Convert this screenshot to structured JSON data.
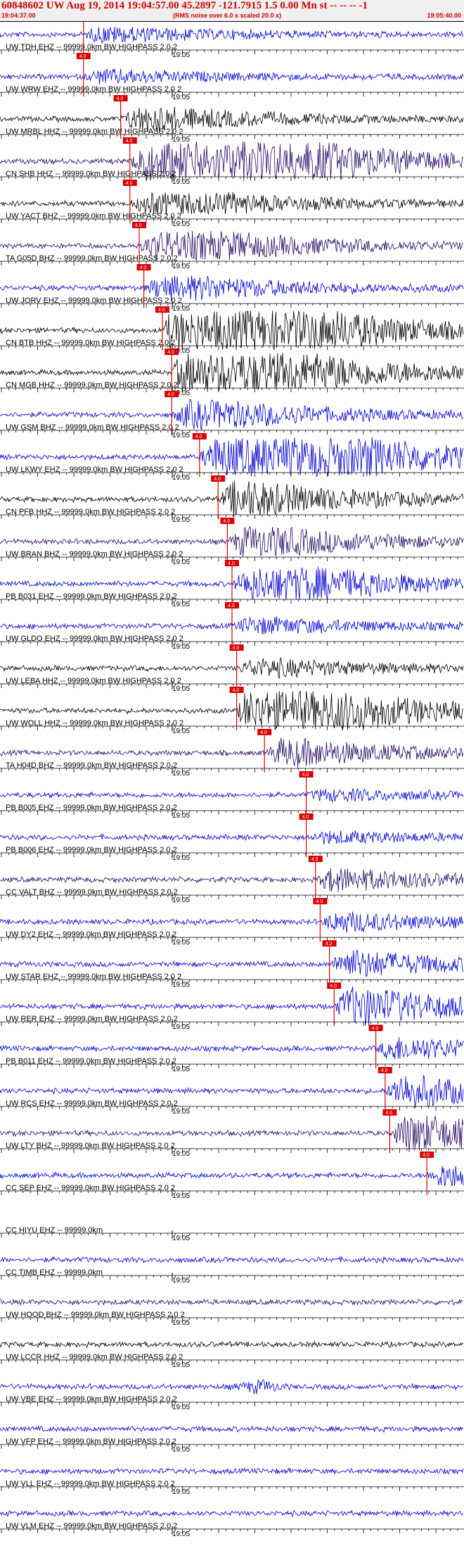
{
  "header": {
    "title": "60848602 UW Aug 19, 2014 19:04:57.00   45.2897 -121.7915  1.5 0.00 Mn st -- -- --  -1",
    "start_time": "19:04:37.00",
    "note": "(RMS noise over 6.0 s scaled 20.0 x)",
    "end_time": "19:05:40.00"
  },
  "axis": {
    "minute_label": "19:05"
  },
  "colors": {
    "black": "#000000",
    "blue": "#0000d0",
    "purple": "#2a0a66",
    "pick": "#dd0000"
  },
  "pick_label": "4.0",
  "traces": [
    {
      "label": "UW TDH EHZ -- 99999.0km BW  HIGHPASS  2.0  2",
      "color": "blue",
      "pick": 0.18,
      "event": 0.25,
      "env": 0.6
    },
    {
      "label": "UW WRW EHZ -- 99999.0km BW  HIGHPASS  2.0  2",
      "color": "blue",
      "pick": 0.18,
      "event": 0.25,
      "env": 0.5
    },
    {
      "label": "UW MRBL HHZ -- 99999.0km BW  HIGHPASS  2.0  2",
      "color": "black",
      "pick": 0.26,
      "event": 0.35,
      "env": 1.0
    },
    {
      "label": "CN SHB HHZ -- 99999.0km BW  HIGHPASS  2.0  2",
      "color": "purple",
      "pick": 0.28,
      "event": 0.55,
      "env": 3.0
    },
    {
      "label": "UW YACT BHZ -- 99999.0km BW  HIGHPASS  2.0  2",
      "color": "black",
      "pick": 0.28,
      "event": 0.5,
      "env": 0.8
    },
    {
      "label": "TA G05D BHZ -- 99999.0km BW  HIGHPASS  2.0  2",
      "color": "purple",
      "pick": 0.3,
      "event": 0.5,
      "env": 1.1
    },
    {
      "label": "UW JORV EHZ -- 99999.0km BW  HIGHPASS  2.0  2",
      "color": "blue",
      "pick": 0.31,
      "event": 0.45,
      "env": 0.9
    },
    {
      "label": "CN BTB HHZ -- 99999.0km BW  HIGHPASS  2.0  2",
      "color": "black",
      "pick": 0.35,
      "event": 0.55,
      "env": 3.2
    },
    {
      "label": "CN MGB HHZ -- 99999.0km BW  HIGHPASS  2.0  2",
      "color": "black",
      "pick": 0.37,
      "event": 0.52,
      "env": 3.0
    },
    {
      "label": "UW GSM BHZ -- 99999.0km BW  HIGHPASS  2.0  2",
      "color": "blue",
      "pick": 0.37,
      "event": 0.5,
      "env": 1.1
    },
    {
      "label": "UW LKWY EHZ -- 99999.0km BW  HIGHPASS  2.0  2",
      "color": "blue",
      "pick": 0.43,
      "event": 0.75,
      "env": 2.0
    },
    {
      "label": "CN PFB HHZ -- 99999.0km BW  HIGHPASS  2.0  2",
      "color": "black",
      "pick": 0.47,
      "event": 0.55,
      "env": 1.5
    },
    {
      "label": "UW BRAN BHZ -- 99999.0km BW  HIGHPASS  2.0  2",
      "color": "purple",
      "pick": 0.49,
      "event": 0.6,
      "env": 1.2
    },
    {
      "label": "PB B031 EHZ -- 99999.0km BW  HIGHPASS  2.0  2",
      "color": "blue",
      "pick": 0.5,
      "event": 0.7,
      "env": 1.3
    },
    {
      "label": "UW GLDO EHZ -- 99999.0km BW  HIGHPASS  2.0  2",
      "color": "blue",
      "pick": 0.5,
      "event": 0.6,
      "env": 0.6
    },
    {
      "label": "UW LEBA HHZ -- 99999.0km BW  HIGHPASS  2.0  2",
      "color": "black",
      "pick": 0.51,
      "event": 0.6,
      "env": 0.7
    },
    {
      "label": "UW WOLL HHZ -- 99999.0km BW  HIGHPASS  2.0  2",
      "color": "black",
      "pick": 0.51,
      "event": 0.6,
      "env": 3.0
    },
    {
      "label": "TA H04D BHZ -- 99999.0km BW  HIGHPASS  2.0  2",
      "color": "purple",
      "pick": 0.57,
      "event": 0.65,
      "env": 1.1
    },
    {
      "label": "PB B005 EHZ -- 99999.0km BW  HIGHPASS  2.0  2",
      "color": "blue",
      "pick": 0.66,
      "event": 0.75,
      "env": 0.4
    },
    {
      "label": "PB B006 EHZ -- 99999.0km BW  HIGHPASS  2.0  2",
      "color": "blue",
      "pick": 0.66,
      "event": 0.75,
      "env": 0.4
    },
    {
      "label": "CC VALT BHZ -- 99999.0km BW  HIGHPASS  2.0  2",
      "color": "purple",
      "pick": 0.68,
      "event": 0.72,
      "env": 1.0
    },
    {
      "label": "UW DY2 EHZ -- 99999.0km BW  HIGHPASS  2.0  2",
      "color": "blue",
      "pick": 0.69,
      "event": 0.75,
      "env": 0.8
    },
    {
      "label": "UW STAR EHZ -- 99999.0km BW  HIGHPASS  2.0  2",
      "color": "blue",
      "pick": 0.71,
      "event": 0.75,
      "env": 1.2
    },
    {
      "label": "UW RER EHZ -- 99999.0km BW  HIGHPASS  2.0  2",
      "color": "blue",
      "pick": 0.72,
      "event": 0.76,
      "env": 1.8
    },
    {
      "label": "PB B011 EHZ -- 99999.0km BW  HIGHPASS  2.0  2",
      "color": "blue",
      "pick": 0.81,
      "event": 0.85,
      "env": 1.0
    },
    {
      "label": "UW RCS EHZ -- 99999.0km BW  HIGHPASS  2.0  2",
      "color": "blue",
      "pick": 0.83,
      "event": 0.87,
      "env": 1.5
    },
    {
      "label": "UW LTY BHZ -- 99999.0km BW  HIGHPASS  2.0  2",
      "color": "purple",
      "pick": 0.84,
      "event": 0.88,
      "env": 1.7
    },
    {
      "label": "CC SEP EHZ -- 99999.0km BW  HIGHPASS  2.0  2",
      "color": "blue",
      "pick": 0.92,
      "event": 0.95,
      "env": 1.0
    },
    {
      "label": "CC HIYU EHZ -- 99999.0km",
      "color": "none",
      "pick": null,
      "event": 0,
      "env": 0
    },
    {
      "label": "CC TIMB EHZ -- 99999.0km",
      "color": "blue",
      "pick": null,
      "event": 0,
      "env": 0
    },
    {
      "label": "UW HOOD BHZ -- 99999.0km BW  HIGHPASS  2.0  2",
      "color": "purple",
      "pick": null,
      "event": 0,
      "env": 0
    },
    {
      "label": "UW LCCR HHZ -- 99999.0km BW  HIGHPASS  2.0  2",
      "color": "black",
      "pick": null,
      "event": 0,
      "env": 0
    },
    {
      "label": "UW VBE EHZ -- 99999.0km BW  HIGHPASS  2.0  2",
      "color": "blue",
      "pick": null,
      "event": 0.56,
      "env": 0.6
    },
    {
      "label": "UW VFP EHZ -- 99999.0km BW  HIGHPASS  2.0  2",
      "color": "blue",
      "pick": null,
      "event": 0,
      "env": 0
    },
    {
      "label": "UW VLL EHZ -- 99999.0km BW  HIGHPASS  2.0  2",
      "color": "blue",
      "pick": null,
      "event": 0,
      "env": 0
    },
    {
      "label": "UW VLM EHZ -- 99999.0km BW  HIGHPASS  2.0  2",
      "color": "blue",
      "pick": null,
      "event": 0,
      "env": 0
    }
  ]
}
